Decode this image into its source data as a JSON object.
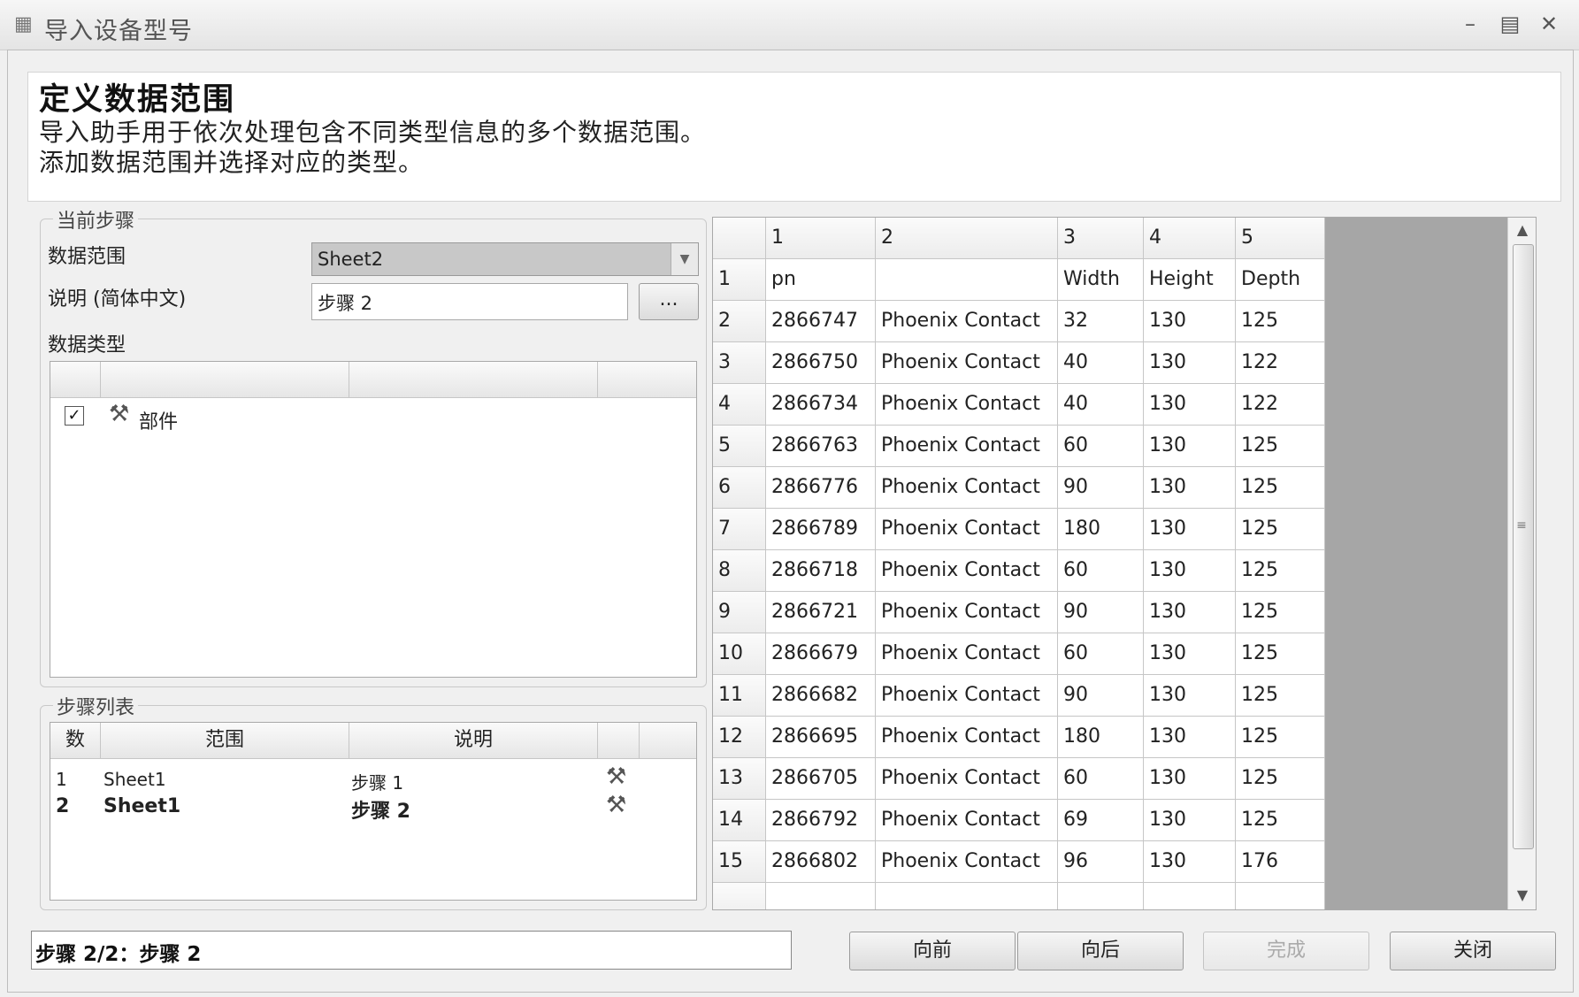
{
  "window": {
    "title": "导入设备型号"
  },
  "header": {
    "title": "定义数据范围",
    "desc_line1": "导入助手用于依次处理包含不同类型信息的多个数据范围。",
    "desc_line2": "添加数据范围并选择对应的类型。"
  },
  "current_step": {
    "group_label": "当前步骤",
    "range_label": "数据范围",
    "range_value": "Sheet2",
    "desc_label": "说明 (简体中文)",
    "desc_value": "步骤 2",
    "browse_label": "...",
    "type_label": "数据类型",
    "type_items": [
      {
        "label": "部件",
        "checked": true
      }
    ]
  },
  "step_list": {
    "group_label": "步骤列表",
    "columns": [
      "数",
      "范围",
      "说明"
    ],
    "rows": [
      {
        "num": "1",
        "range": "Sheet1",
        "desc": "步骤 1"
      },
      {
        "num": "2",
        "range": "Sheet1",
        "desc": "步骤 2"
      }
    ]
  },
  "grid": {
    "col_headers": [
      "1",
      "2",
      "3",
      "4",
      "5"
    ],
    "rows": [
      [
        "1",
        "pn",
        "",
        "Width",
        "Height",
        "Depth"
      ],
      [
        "2",
        "2866747",
        "Phoenix Contact",
        "32",
        "130",
        "125"
      ],
      [
        "3",
        "2866750",
        "Phoenix Contact",
        "40",
        "130",
        "122"
      ],
      [
        "4",
        "2866734",
        "Phoenix Contact",
        "40",
        "130",
        "122"
      ],
      [
        "5",
        "2866763",
        "Phoenix Contact",
        "60",
        "130",
        "125"
      ],
      [
        "6",
        "2866776",
        "Phoenix Contact",
        "90",
        "130",
        "125"
      ],
      [
        "7",
        "2866789",
        "Phoenix Contact",
        "180",
        "130",
        "125"
      ],
      [
        "8",
        "2866718",
        "Phoenix Contact",
        "60",
        "130",
        "125"
      ],
      [
        "9",
        "2866721",
        "Phoenix Contact",
        "90",
        "130",
        "125"
      ],
      [
        "10",
        "2866679",
        "Phoenix Contact",
        "60",
        "130",
        "125"
      ],
      [
        "11",
        "2866682",
        "Phoenix Contact",
        "90",
        "130",
        "125"
      ],
      [
        "12",
        "2866695",
        "Phoenix Contact",
        "180",
        "130",
        "125"
      ],
      [
        "13",
        "2866705",
        "Phoenix Contact",
        "60",
        "130",
        "125"
      ],
      [
        "14",
        "2866792",
        "Phoenix Contact",
        "69",
        "130",
        "125"
      ],
      [
        "15",
        "2866802",
        "Phoenix Contact",
        "96",
        "130",
        "176"
      ]
    ]
  },
  "status": {
    "text": "步骤 2/2：步骤 2"
  },
  "buttons": {
    "prev": "向前",
    "next": "向后",
    "finish": "完成",
    "close": "关闭"
  }
}
